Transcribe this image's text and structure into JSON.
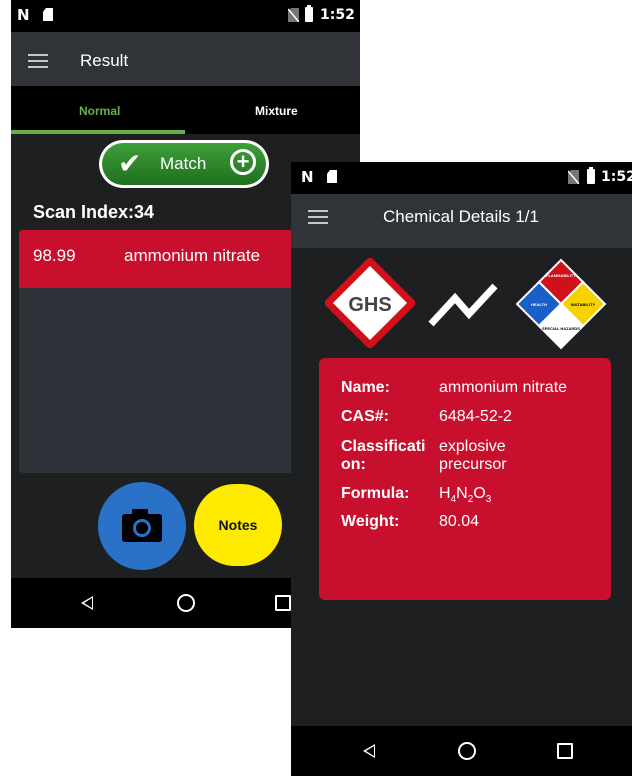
{
  "colors": {
    "accent_green": "#69b04a",
    "result_red": "#c8102e",
    "camera_blue": "#2a72c8",
    "notes_yellow": "#ffeb00"
  },
  "left_screen": {
    "status": {
      "time": "1:52"
    },
    "appbar": {
      "title": "Result",
      "menu_icon": "hamburger-icon"
    },
    "tabs": [
      {
        "label": "Normal",
        "selected": true
      },
      {
        "label": "Mixture",
        "selected": false
      }
    ],
    "match_button": {
      "label": "Match",
      "check_icon": "checkmark-icon",
      "plus_icon": "plus-circle-icon"
    },
    "scan_index": "Scan Index:34",
    "results": [
      {
        "score": "98.99",
        "name": "ammonium nitrate"
      }
    ],
    "camera_button": {
      "icon": "camera-icon"
    },
    "notes_button": {
      "label": "Notes"
    }
  },
  "right_screen": {
    "status": {
      "time": "1:52"
    },
    "appbar": {
      "title": "Chemical Details 1/1",
      "menu_icon": "hamburger-icon"
    },
    "hazard_icons": [
      {
        "icon": "ghs-icon",
        "text": "GHS"
      },
      {
        "icon": "spectrum-line-icon"
      },
      {
        "icon": "nfpa-diamond-icon",
        "quadrants": [
          "FLAMMABILITY",
          "HEALTH",
          "INSTABILITY",
          "SPECIAL HAZARDS"
        ]
      }
    ],
    "details": {
      "name_label": "Name:",
      "name_value": "ammonium nitrate",
      "cas_label": "CAS#:",
      "cas_value": "6484-52-2",
      "class_label_1": "Classificati",
      "class_label_2": "on:",
      "class_value_1": "explosive",
      "class_value_2": "precursor",
      "formula_label": "Formula:",
      "formula_parts": [
        "H",
        "4",
        "N",
        "2",
        "O",
        "3"
      ],
      "weight_label": "Weight:",
      "weight_value": "80.04"
    }
  }
}
